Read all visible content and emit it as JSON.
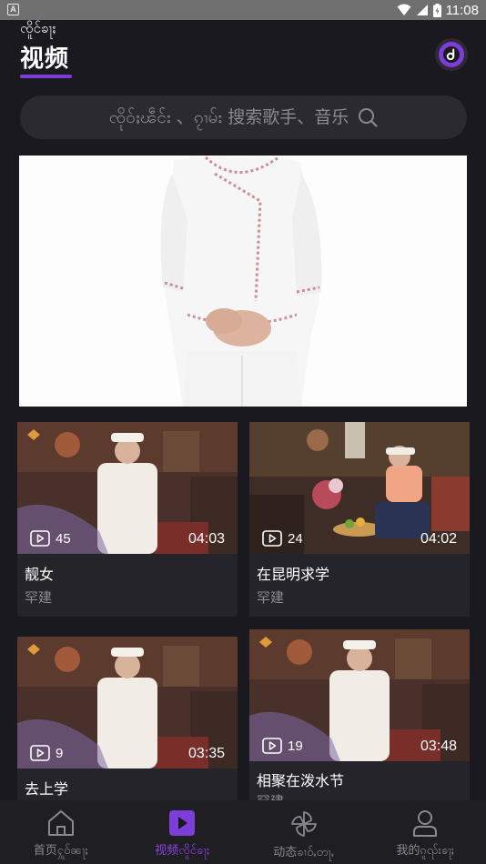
{
  "status_bar": {
    "time": "11:08"
  },
  "header": {
    "subtitle": "ၸိူင်ၶႃႈ",
    "title": "视频"
  },
  "search": {
    "placeholder": "ၸိုဝ်ႈၽဵင်း 、ၵႂၢမ်း 搜索歌手、音乐"
  },
  "videos": [
    {
      "title": "靓女",
      "artist": "罕建",
      "plays": "45",
      "duration": "04:03"
    },
    {
      "title": "在昆明求学",
      "artist": "罕建",
      "plays": "24",
      "duration": "04:02"
    },
    {
      "title": "去上学",
      "artist": "",
      "plays": "9",
      "duration": "03:35"
    },
    {
      "title": "相聚在泼水节",
      "artist": "罕建",
      "plays": "19",
      "duration": "03:48"
    }
  ],
  "tabs": [
    {
      "label": "首页ႁူဝ်ၼႃႈ",
      "icon": "home-icon",
      "active": false
    },
    {
      "label": "视频ၸိူင်ၶႃႈ",
      "icon": "video-play-icon",
      "active": true
    },
    {
      "label": "动态ၶၢဝ်ႇတႃႇ",
      "icon": "pinwheel-icon",
      "active": false
    },
    {
      "label": "我的ၵူၺ်းၶႃႈ",
      "icon": "user-icon",
      "active": false
    }
  ],
  "colors": {
    "accent": "#7b3ed8",
    "background": "#1a191f",
    "card": "#25242a"
  }
}
